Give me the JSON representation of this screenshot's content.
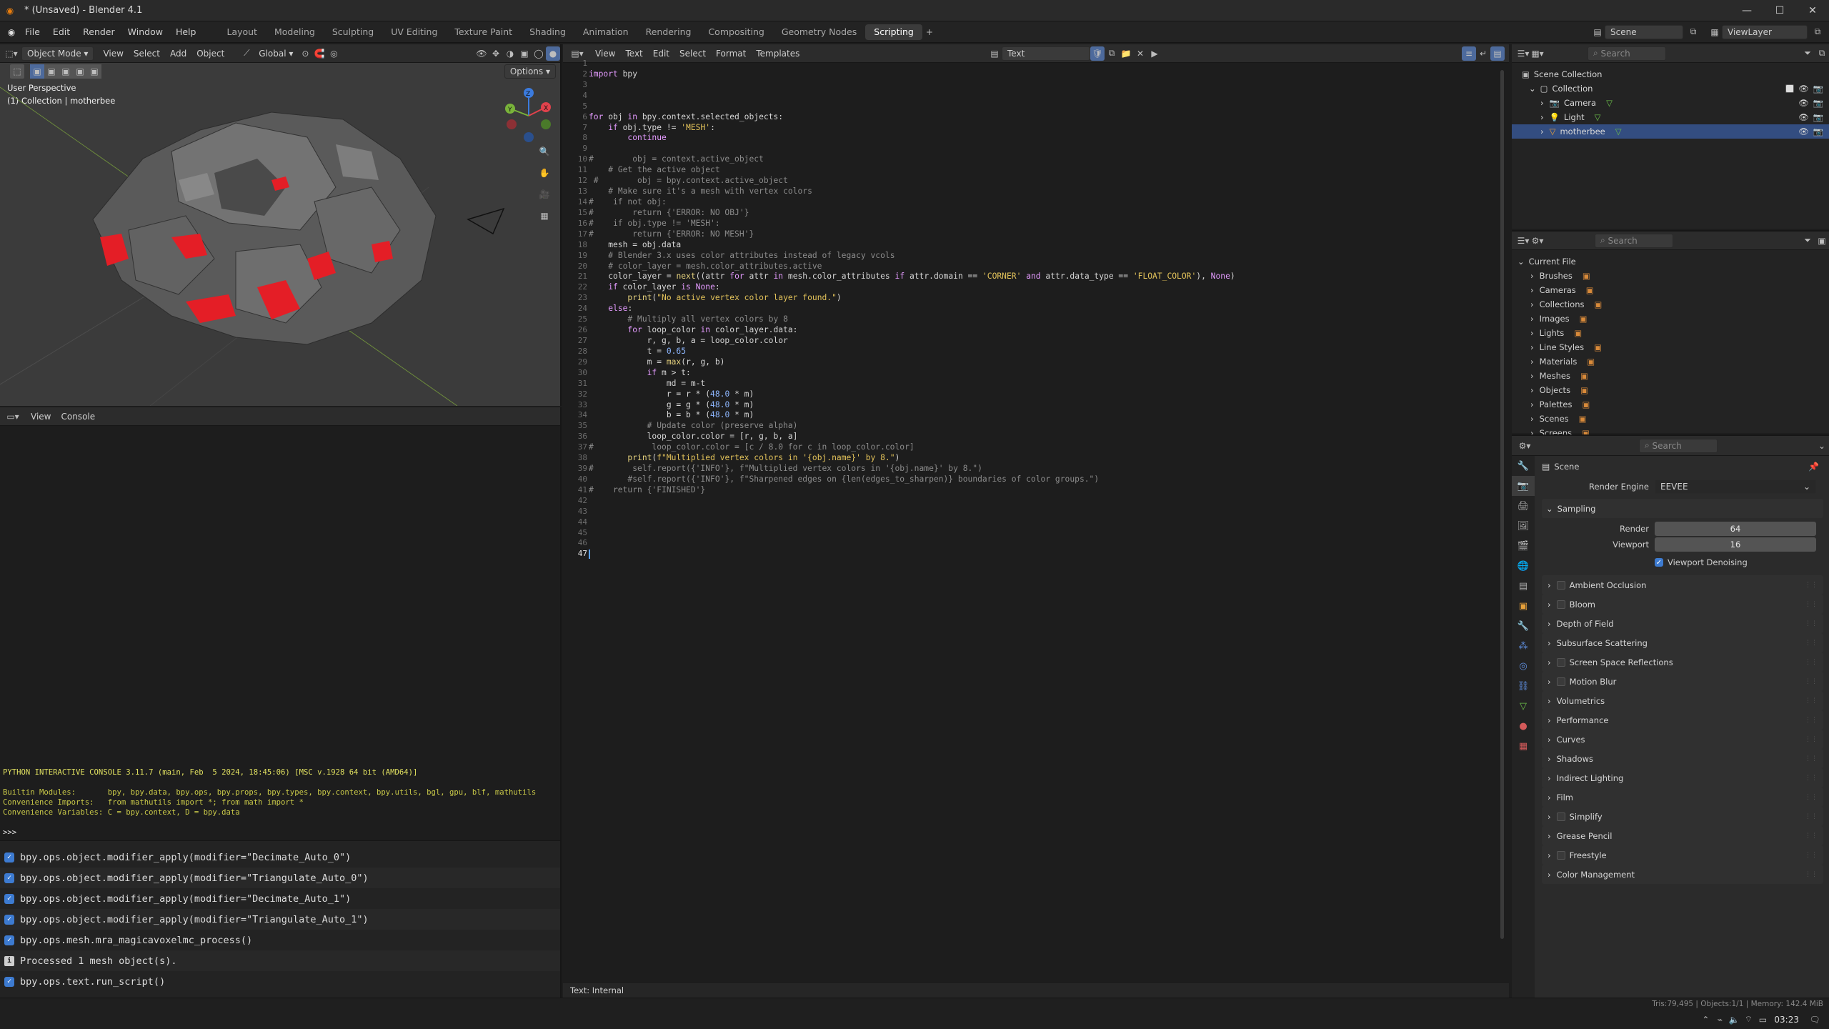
{
  "window": {
    "title": "* (Unsaved) - Blender 4.1"
  },
  "topbar": {
    "menus": [
      "File",
      "Edit",
      "Render",
      "Window",
      "Help"
    ],
    "workspaces": [
      "Layout",
      "Modeling",
      "Sculpting",
      "UV Editing",
      "Texture Paint",
      "Shading",
      "Animation",
      "Rendering",
      "Compositing",
      "Geometry Nodes",
      "Scripting"
    ],
    "active_workspace": "Scripting",
    "scene_label": "Scene",
    "viewlayer_label": "ViewLayer"
  },
  "viewport": {
    "mode": "Object Mode",
    "menus": [
      "View",
      "Select",
      "Add",
      "Object"
    ],
    "transform": "Global",
    "options": "Options",
    "overlay_title": "User Perspective",
    "overlay_subtitle": "(1) Collection | motherbee"
  },
  "console": {
    "menus": [
      "View",
      "Console"
    ],
    "lines": [
      "PYTHON INTERACTIVE CONSOLE 3.11.7 (main, Feb  5 2024, 18:45:06) [MSC v.1928 64 bit (AMD64)]",
      "",
      "Builtin Modules:       bpy, bpy.data, bpy.ops, bpy.props, bpy.types, bpy.context, bpy.utils, bgl, gpu, blf, mathutils",
      "Convenience Imports:   from mathutils import *; from math import *",
      "Convenience Variables: C = bpy.context, D = bpy.data",
      "",
      ">>> "
    ]
  },
  "infolog": {
    "entries": [
      {
        "type": "op",
        "text": "bpy.ops.object.modifier_apply(modifier=\"Decimate_Auto_0\")"
      },
      {
        "type": "op",
        "text": "bpy.ops.object.modifier_apply(modifier=\"Triangulate_Auto_0\")"
      },
      {
        "type": "op",
        "text": "bpy.ops.object.modifier_apply(modifier=\"Decimate_Auto_1\")"
      },
      {
        "type": "op",
        "text": "bpy.ops.object.modifier_apply(modifier=\"Triangulate_Auto_1\")"
      },
      {
        "type": "op",
        "text": "bpy.ops.mesh.mra_magicavoxelmc_process()"
      },
      {
        "type": "info",
        "text": "Processed 1 mesh object(s)."
      },
      {
        "type": "op",
        "text": "bpy.ops.text.run_script()"
      }
    ]
  },
  "texteditor": {
    "menus": [
      "View",
      "Text",
      "Edit",
      "Select",
      "Format",
      "Templates"
    ],
    "datablock": "Text",
    "footer": "Text: Internal",
    "current_line": 47,
    "lines": [
      "",
      "import bpy",
      "",
      "",
      "",
      "for obj in bpy.context.selected_objects:",
      "    if obj.type != 'MESH':",
      "        continue",
      "",
      "#        obj = context.active_object",
      "    # Get the active object",
      " #        obj = bpy.context.active_object",
      "    # Make sure it's a mesh with vertex colors",
      "#    if not obj:",
      "#        return {'ERROR: NO OBJ'}",
      "#    if obj.type != 'MESH':",
      "#        return {'ERROR: NO MESH'}",
      "    mesh = obj.data",
      "    # Blender 3.x uses color attributes instead of legacy vcols",
      "    # color_layer = mesh.color_attributes.active",
      "    color_layer = next((attr for attr in mesh.color_attributes if attr.domain == 'CORNER' and attr.data_type == 'FLOAT_COLOR'), None)",
      "    if color_layer is None:",
      "        print(\"No active vertex color layer found.\")",
      "    else:",
      "        # Multiply all vertex colors by 8",
      "        for loop_color in color_layer.data:",
      "            r, g, b, a = loop_color.color",
      "            t = 0.65",
      "            m = max(r, g, b)",
      "            if m > t:",
      "                md = m-t",
      "                r = r * (48.0 * m)",
      "                g = g * (48.0 * m)",
      "                b = b * (48.0 * m)",
      "            # Update color (preserve alpha)",
      "            loop_color.color = [r, g, b, a]",
      "#            loop_color.color = [c / 8.0 for c in loop_color.color]",
      "        print(f\"Multiplied vertex colors in '{obj.name}' by 8.\")",
      "#        self.report({'INFO'}, f\"Multiplied vertex colors in '{obj.name}' by 8.\")",
      "        #self.report({'INFO'}, f\"Sharpened edges on {len(edges_to_sharpen)} boundaries of color groups.\")",
      "#    return {'FINISHED'}",
      "",
      "",
      "",
      "",
      "",
      ""
    ]
  },
  "outliner": {
    "search_placeholder": "Search",
    "root": "Scene Collection",
    "collection": "Collection",
    "items": [
      "Camera",
      "Light",
      "motherbee"
    ],
    "selected": "motherbee"
  },
  "blenddata": {
    "search_placeholder": "Search",
    "root": "Current File",
    "items": [
      "Brushes",
      "Cameras",
      "Collections",
      "Images",
      "Lights",
      "Line Styles",
      "Materials",
      "Meshes",
      "Objects",
      "Palettes",
      "Scenes",
      "Screens"
    ]
  },
  "properties": {
    "search_placeholder": "Search",
    "context": "Scene",
    "render_engine_label": "Render Engine",
    "render_engine": "EEVEE",
    "sampling_label": "Sampling",
    "render_label": "Render",
    "render_samples": "64",
    "viewport_label": "Viewport",
    "viewport_samples": "16",
    "viewport_denoising": "Viewport Denoising",
    "panels": [
      {
        "label": "Ambient Occlusion",
        "check": true
      },
      {
        "label": "Bloom",
        "check": true
      },
      {
        "label": "Depth of Field",
        "check": false
      },
      {
        "label": "Subsurface Scattering",
        "check": false
      },
      {
        "label": "Screen Space Reflections",
        "check": true
      },
      {
        "label": "Motion Blur",
        "check": true
      },
      {
        "label": "Volumetrics",
        "check": false
      },
      {
        "label": "Performance",
        "check": false
      },
      {
        "label": "Curves",
        "check": false
      },
      {
        "label": "Shadows",
        "check": false
      },
      {
        "label": "Indirect Lighting",
        "check": false
      },
      {
        "label": "Film",
        "check": false
      },
      {
        "label": "Simplify",
        "check": true
      },
      {
        "label": "Grease Pencil",
        "check": false
      },
      {
        "label": "Freestyle",
        "check": true
      },
      {
        "label": "Color Management",
        "check": false
      }
    ]
  },
  "status": {
    "stats": "Tris:79,495 | Objects:1/1 | Memory: 142.4 MiB",
    "time": "03:23"
  },
  "colors": {
    "accent": "#3d7bd1",
    "selection": "#334d80",
    "background": "#1d1d1d"
  }
}
